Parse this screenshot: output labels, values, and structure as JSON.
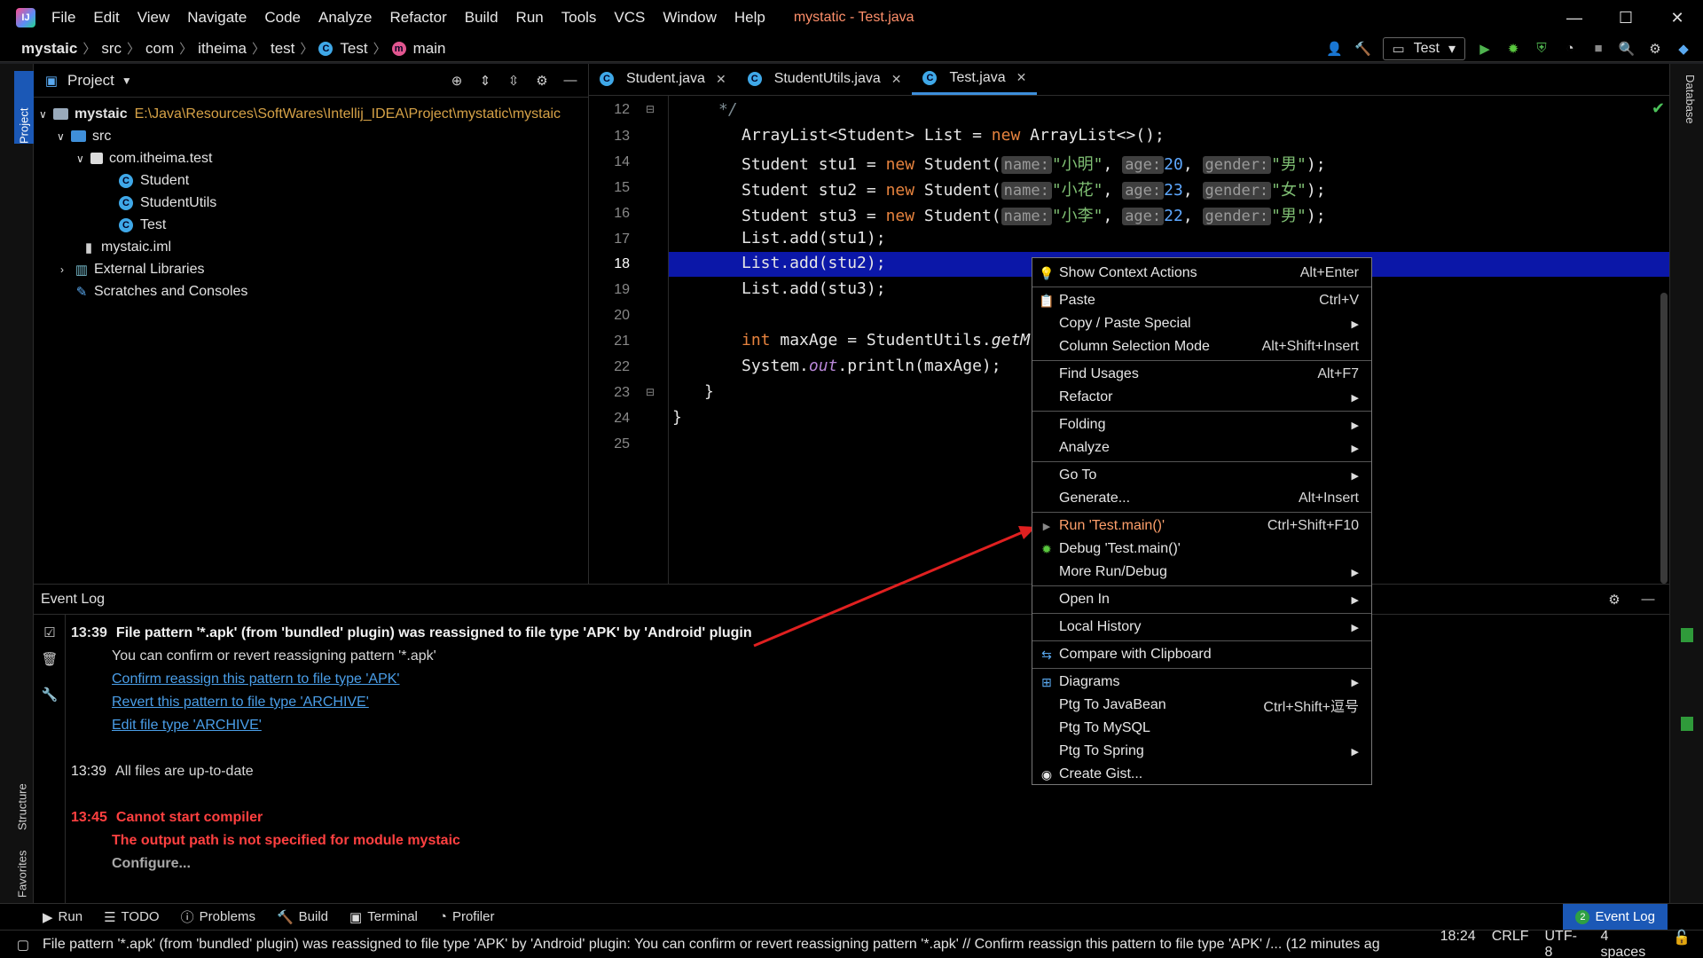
{
  "title_bar": {
    "logo": "IJ",
    "menus": [
      "File",
      "Edit",
      "View",
      "Navigate",
      "Code",
      "Analyze",
      "Refactor",
      "Build",
      "Run",
      "Tools",
      "VCS",
      "Window",
      "Help"
    ],
    "window_title": "mystatic - Test.java",
    "minimize": "—",
    "maximize": "☐",
    "close": "✕"
  },
  "breadcrumb": {
    "items": [
      "mystaic",
      "src",
      "com",
      "itheima",
      "test",
      "Test",
      "main"
    ]
  },
  "run_config": {
    "label": "Test"
  },
  "left_stripe": {
    "project": "Project",
    "structure": "Structure",
    "favorites": "Favorites"
  },
  "right_stripe": {
    "database": "Database"
  },
  "project_panel": {
    "title": "Project",
    "root_name": "mystaic",
    "root_path": "E:\\Java\\Resources\\SoftWares\\Intellij_IDEA\\Project\\mystatic\\mystaic",
    "src": "src",
    "package": "com.itheima.test",
    "classes": [
      "Student",
      "StudentUtils",
      "Test"
    ],
    "iml": "mystaic.iml",
    "ext_libs": "External Libraries",
    "scratches": "Scratches and Consoles"
  },
  "editor_tabs": [
    {
      "label": "Student.java"
    },
    {
      "label": "StudentUtils.java"
    },
    {
      "label": "Test.java"
    }
  ],
  "code": {
    "line_numbers": [
      "12",
      "13",
      "14",
      "15",
      "16",
      "17",
      "18",
      "19",
      "20",
      "21",
      "22",
      "23",
      "24",
      "25"
    ],
    "l12": "*/",
    "l13": "ArrayList<Student> List = new ArrayList<>();",
    "l14_pre": "Student stu1 = ",
    "l14_name": "\"小明\"",
    "l14_age": "20",
    "l14_gender": "\"男\"",
    "l15_pre": "Student stu2 = ",
    "l15_name": "\"小花\"",
    "l15_age": "23",
    "l15_gender": "\"女\"",
    "l16_pre": "Student stu3 = ",
    "l16_name": "\"小李\"",
    "l16_age": "22",
    "l16_gender": "\"男\"",
    "kw_new": "new",
    "ctor": "Student(",
    "hint_name": "name:",
    "hint_age": "age:",
    "hint_gender": "gender:",
    "l17": "List.add(stu1);",
    "l18": "List.add(stu2);",
    "l19": "List.add(stu3);",
    "l21_kw": "int",
    "l21_rest": " maxAge = StudentUtils.",
    "l21_it": "getM",
    "l22_a": "System.",
    "l22_it": "out",
    "l22_b": ".println(maxAge);",
    "l23": "}",
    "l24": "}"
  },
  "context_menu": {
    "items": [
      {
        "label": "Show Context Actions",
        "shortcut": "Alt+Enter"
      },
      {
        "label": "Paste",
        "shortcut": "Ctrl+V"
      },
      {
        "label": "Copy / Paste Special",
        "shortcut": ""
      },
      {
        "label": "Column Selection Mode",
        "shortcut": "Alt+Shift+Insert"
      },
      {
        "label": "Find Usages",
        "shortcut": "Alt+F7"
      },
      {
        "label": "Refactor",
        "shortcut": ""
      },
      {
        "label": "Folding",
        "shortcut": ""
      },
      {
        "label": "Analyze",
        "shortcut": ""
      },
      {
        "label": "Go To",
        "shortcut": ""
      },
      {
        "label": "Generate...",
        "shortcut": "Alt+Insert"
      },
      {
        "label": "Run 'Test.main()'",
        "shortcut": "Ctrl+Shift+F10"
      },
      {
        "label": "Debug 'Test.main()'",
        "shortcut": ""
      },
      {
        "label": "More Run/Debug",
        "shortcut": ""
      },
      {
        "label": "Open In",
        "shortcut": ""
      },
      {
        "label": "Local History",
        "shortcut": ""
      },
      {
        "label": "Compare with Clipboard",
        "shortcut": ""
      },
      {
        "label": "Diagrams",
        "shortcut": ""
      },
      {
        "label": "Ptg To JavaBean",
        "shortcut": "Ctrl+Shift+逗号"
      },
      {
        "label": "Ptg To MySQL",
        "shortcut": ""
      },
      {
        "label": "Ptg To Spring",
        "shortcut": ""
      },
      {
        "label": "Create Gist...",
        "shortcut": ""
      }
    ]
  },
  "event_log": {
    "title": "Event Log",
    "e1_time": "13:39",
    "e1_title": "File pattern '*.apk' (from 'bundled' plugin) was reassigned to file type 'APK' by 'Android' plugin",
    "e1_body": "You can confirm or revert reassigning pattern '*.apk'",
    "e1_link1": "Confirm reassign this pattern to file type 'APK'",
    "e1_link2": "Revert this pattern to file type 'ARCHIVE'",
    "e1_link3": "Edit file type 'ARCHIVE'",
    "e2_time": "13:39",
    "e2_text": "All files are up-to-date",
    "e3_time": "13:45",
    "e3_title": "Cannot start compiler",
    "e3_body": "The output path is not specified for module mystaic",
    "e3_link": "Configure..."
  },
  "bottom_tools": {
    "run": "Run",
    "todo": "TODO",
    "problems": "Problems",
    "build": "Build",
    "terminal": "Terminal",
    "profiler": "Profiler",
    "event_log_badge": "2",
    "event_log": "Event Log"
  },
  "status_bar": {
    "message": "File pattern '*.apk' (from 'bundled' plugin) was reassigned to file type 'APK' by 'Android' plugin: You can confirm or revert reassigning pattern '*.apk' // Confirm reassign this pattern to file type 'APK' /... (12 minutes ag",
    "position": "18:24",
    "line_sep": "CRLF",
    "encoding": "UTF-8",
    "indent": "4 spaces"
  },
  "colors": {
    "accent": "#3d8fdb",
    "selected_line": "#0b17a8",
    "error": "#ff4040",
    "link": "#4a9ee8",
    "annotation_arrow": "#e02020"
  }
}
